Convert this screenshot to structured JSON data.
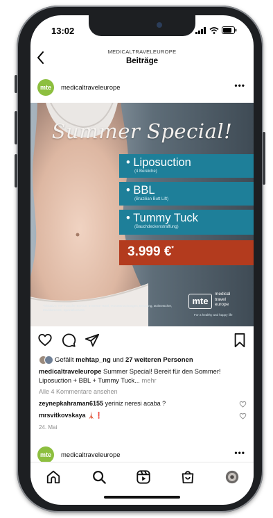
{
  "status": {
    "time": "13:02"
  },
  "header": {
    "subtitle": "MEDICALTRAVELEUROPE",
    "title": "Beiträge"
  },
  "post": {
    "avatar_text": "mte",
    "account": "medicaltraveleurope",
    "more": "•••",
    "image": {
      "headline": "Summer Special!",
      "offers": [
        {
          "title": "• Liposuction",
          "sub": "(4 Bereiche)"
        },
        {
          "title": "• BBL",
          "sub": "(Brazilian Butt Lift)"
        },
        {
          "title": "• Tummy Tuck",
          "sub": "(Bauchdeckenstraffung)"
        }
      ],
      "price": "3.999 €",
      "price_mark": "*",
      "logo_mark": "mte",
      "logo_line1": "medical",
      "logo_line2": "travel",
      "logo_line3": "europe",
      "slogan": "For a healthy and happy life",
      "footnote": "*inklusive: VIP-Transfer-Service, 5-Sterne-Hotel, Voruntersuchungen, Beratung, Dolmetscher, Medikamente, Spezialkorsetts"
    },
    "likes": {
      "prefix": "Gefällt ",
      "user": "mehtap_ng",
      "mid": " und ",
      "count": "27 weiteren Personen"
    },
    "caption": {
      "user": "medicaltraveleurope",
      "text": " Summer Special! Bereit für den Sommer! Liposuction + BBL + Tummy Tuck...",
      "more": " mehr"
    },
    "all_comments": "Alle 4 Kommentare ansehen",
    "comments": [
      {
        "user": "zeynepkahraman6155",
        "text": " yeriniz neresi acaba ?"
      },
      {
        "user": "mrsvitkovskaya",
        "text": " 🗼❗"
      }
    ],
    "date": "24. Mai"
  },
  "next_post": {
    "avatar_text": "mte",
    "account": "medicaltraveleurope",
    "more": "•••"
  },
  "tabs": [
    "home-icon",
    "search-icon",
    "reels-icon",
    "shop-icon",
    "profile-icon"
  ],
  "colors": {
    "offer_blue": "#1e7f99",
    "price_red": "#b33b1e",
    "brand_green": "#8dbf3f"
  }
}
